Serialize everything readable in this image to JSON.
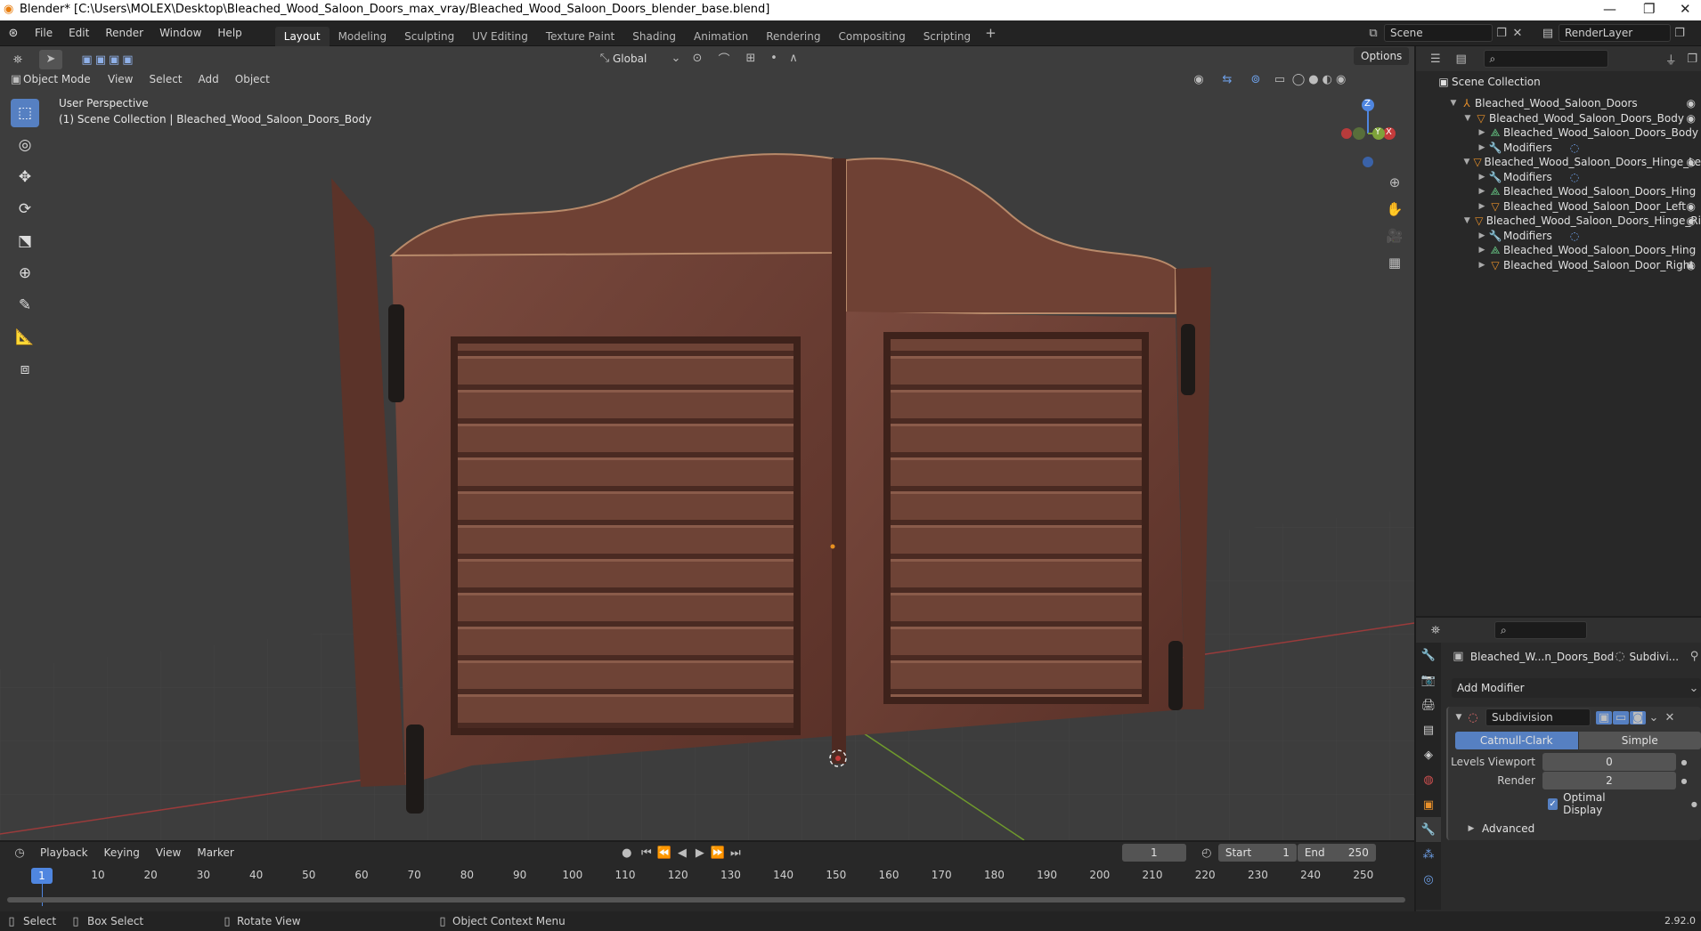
{
  "window": {
    "title": "Blender* [C:\\Users\\MOLEX\\Desktop\\Bleached_Wood_Saloon_Doors_max_vray/Bleached_Wood_Saloon_Doors_blender_base.blend]",
    "minimize": "—",
    "maximize": "❐",
    "close": "✕"
  },
  "menus": [
    "File",
    "Edit",
    "Render",
    "Window",
    "Help"
  ],
  "workspaces": [
    {
      "label": "Layout",
      "active": true
    },
    {
      "label": "Modeling"
    },
    {
      "label": "Sculpting"
    },
    {
      "label": "UV Editing"
    },
    {
      "label": "Texture Paint"
    },
    {
      "label": "Shading"
    },
    {
      "label": "Animation"
    },
    {
      "label": "Rendering"
    },
    {
      "label": "Compositing"
    },
    {
      "label": "Scripting"
    }
  ],
  "workspace_add": "+",
  "scene": {
    "name": "Scene",
    "render_layer": "RenderLayer"
  },
  "header": {
    "transform": "Global",
    "options": "Options",
    "mode": "Object Mode",
    "view": "View",
    "select": "Select",
    "add": "Add",
    "object": "Object"
  },
  "viewport": {
    "perspective": "User Perspective",
    "collection": "(1) Scene Collection | Bleached_Wood_Saloon_Doors_Body",
    "gizmo": {
      "z": "Z",
      "y": "Y",
      "x": "X"
    }
  },
  "outliner": {
    "root": "Scene Collection",
    "rows": [
      {
        "label": "Bleached_Wood_Saloon_Doors",
        "indent": 1,
        "icon": "empty",
        "eye": true
      },
      {
        "label": "Bleached_Wood_Saloon_Doors_Body",
        "indent": 2,
        "icon": "mesh-object",
        "eye": true
      },
      {
        "label": "Bleached_Wood_Saloon_Doors_Body",
        "indent": 3,
        "icon": "mesh-data",
        "eye": false
      },
      {
        "label": "Modifiers",
        "indent": 3,
        "icon": "wrench",
        "eye": false
      },
      {
        "label": "Bleached_Wood_Saloon_Doors_Hinge_Le",
        "indent": 2,
        "icon": "mesh-object",
        "eye": true
      },
      {
        "label": "Modifiers",
        "indent": 3,
        "icon": "wrench",
        "eye": false
      },
      {
        "label": "Bleached_Wood_Saloon_Doors_Hing",
        "indent": 3,
        "icon": "mesh-data",
        "eye": false
      },
      {
        "label": "Bleached_Wood_Saloon_Door_Left",
        "indent": 3,
        "icon": "mesh-object",
        "eye": true
      },
      {
        "label": "Bleached_Wood_Saloon_Doors_Hinge_Ri",
        "indent": 2,
        "icon": "mesh-object",
        "eye": true
      },
      {
        "label": "Modifiers",
        "indent": 3,
        "icon": "wrench",
        "eye": false
      },
      {
        "label": "Bleached_Wood_Saloon_Doors_Hing",
        "indent": 3,
        "icon": "mesh-data",
        "eye": false
      },
      {
        "label": "Bleached_Wood_Saloon_Door_Right",
        "indent": 3,
        "icon": "mesh-object",
        "eye": true
      }
    ]
  },
  "properties": {
    "object_name": "Bleached_W...n_Doors_Bod",
    "modifier_short": "Subdivi...",
    "add_modifier": "Add Modifier",
    "modifier_name": "Subdivision",
    "catmull": "Catmull-Clark",
    "simple": "Simple",
    "levels_viewport_label": "Levels Viewport",
    "levels_viewport": "0",
    "render_label": "Render",
    "render": "2",
    "optimal_display": "Optimal Display",
    "advanced": "Advanced"
  },
  "timeline": {
    "playback": "Playback",
    "keying": "Keying",
    "view": "View",
    "marker": "Marker",
    "current": "1",
    "start_label": "Start",
    "start": "1",
    "end_label": "End",
    "end": "250",
    "ticks": [
      "10",
      "20",
      "30",
      "40",
      "50",
      "60",
      "70",
      "80",
      "90",
      "100",
      "110",
      "120",
      "130",
      "140",
      "150",
      "160",
      "170",
      "180",
      "190",
      "200",
      "210",
      "220",
      "230",
      "240",
      "250"
    ],
    "playhead": "1"
  },
  "status": {
    "select": "Select",
    "box_select": "Box Select",
    "rotate": "Rotate View",
    "context": "Object Context Menu",
    "version": "2.92.0"
  },
  "colors": {
    "accent": "#5680c2",
    "wood": "#6b3f33",
    "axis_x": "#c43b3b",
    "axis_y": "#7ea33a"
  }
}
